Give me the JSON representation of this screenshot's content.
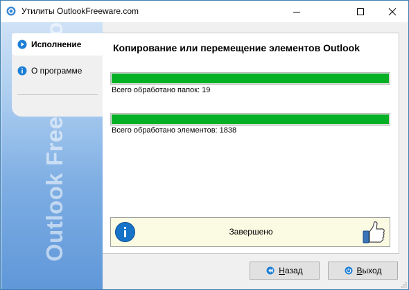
{
  "window": {
    "title": "Утилиты OutlookFreeware.com"
  },
  "sidebar": {
    "brand": "Outlook Freeware .com",
    "items": [
      {
        "label": "Исполнение",
        "icon": "play-arrow-icon",
        "active": true
      },
      {
        "label": "О программе",
        "icon": "info-icon",
        "active": false
      }
    ]
  },
  "main": {
    "title": "Копирование или перемещение элементов Outlook",
    "progress": [
      {
        "label": "Всего обработано папок: 19",
        "fraction": 1.0
      },
      {
        "label": "Всего обработано элементов: 1838",
        "fraction": 1.0
      }
    ],
    "status": {
      "text": "Завершено",
      "icon": "info-icon",
      "badge": "thumbs-up-icon"
    }
  },
  "buttons": {
    "back": {
      "label_hotkey": "Н",
      "label_rest": "азад",
      "icon": "back-icon"
    },
    "exit": {
      "label_hotkey": "В",
      "label_rest": "ыход",
      "icon": "power-icon"
    }
  },
  "colors": {
    "progress": "#06b025",
    "accent": "#1673c8",
    "sidebar": "#7eaee3",
    "status_bg": "#fbfbe3"
  }
}
